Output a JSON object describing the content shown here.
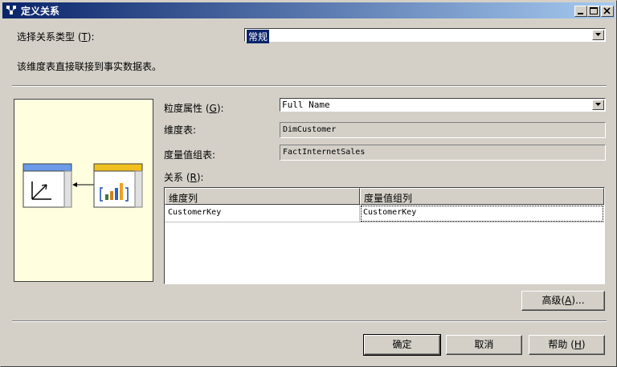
{
  "window": {
    "title": "定义关系"
  },
  "relationship_type": {
    "label": "选择关系类型",
    "hotkey": "T",
    "value": "常规"
  },
  "description": "该维度表直接联接到事实数据表。",
  "granularity": {
    "label": "粒度属性",
    "hotkey": "G",
    "value": "Full Name"
  },
  "dimension_table": {
    "label": "维度表:",
    "value": "DimCustomer"
  },
  "measure_group_table": {
    "label": "度量值组表:",
    "value": "FactInternetSales"
  },
  "relationships": {
    "label": "关系",
    "hotkey": "R",
    "columns": [
      "维度列",
      "度量值组列"
    ],
    "rows": [
      [
        "CustomerKey",
        "CustomerKey"
      ]
    ]
  },
  "buttons": {
    "advanced": {
      "label": "高级",
      "hotkey": "A",
      "suffix": "..."
    },
    "ok": "确定",
    "cancel": "取消",
    "help": {
      "label": "帮助",
      "hotkey": "H"
    }
  },
  "colors": {
    "title_start": "#0a246a",
    "title_end": "#a6caf0",
    "preview_bg": "#ffffe0",
    "face": "#d4d0c8"
  },
  "icons": [
    "window-app-icon",
    "minimize-icon",
    "maximize-icon",
    "close-icon",
    "dropdown-arrow-icon",
    "dimension-table-icon",
    "fact-table-icon",
    "relationship-arrow-icon"
  ]
}
